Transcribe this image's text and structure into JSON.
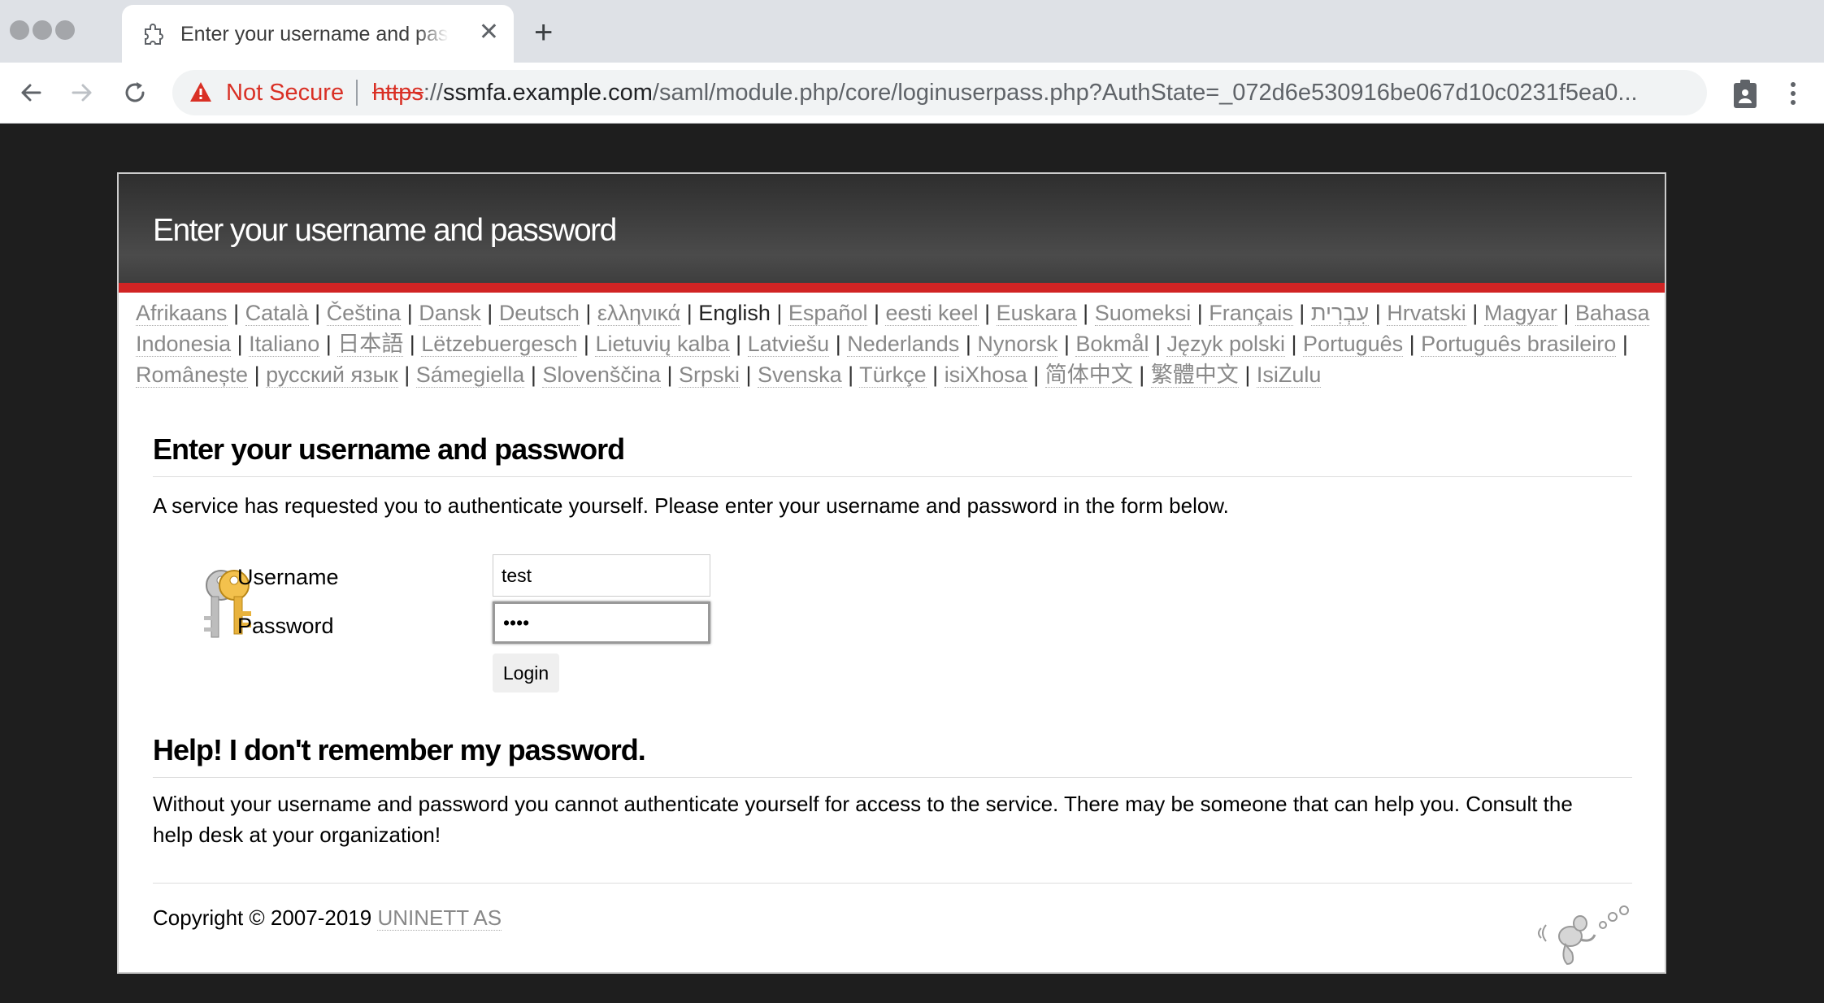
{
  "browser": {
    "tab_title": "Enter your username and password",
    "tab_close": "✕",
    "new_tab": "+",
    "security_label": "Not Secure",
    "url_scheme": "https",
    "url_sep": "://",
    "url_host": "ssmfa.example.com",
    "url_path": "/saml/module.php/core/loginuserpass.php?AuthState=_072d6e530916be067d10c0231f5ea0..."
  },
  "page": {
    "banner_title": "Enter your username and password",
    "languages": [
      {
        "label": "Afrikaans",
        "current": false
      },
      {
        "label": "Català",
        "current": false
      },
      {
        "label": "Čeština",
        "current": false
      },
      {
        "label": "Dansk",
        "current": false
      },
      {
        "label": "Deutsch",
        "current": false
      },
      {
        "label": "ελληνικά",
        "current": false
      },
      {
        "label": "English",
        "current": true
      },
      {
        "label": "Español",
        "current": false
      },
      {
        "label": "eesti keel",
        "current": false
      },
      {
        "label": "Euskara",
        "current": false
      },
      {
        "label": "Suomeksi",
        "current": false
      },
      {
        "label": "Français",
        "current": false
      },
      {
        "label": "עִבְרִית",
        "current": false
      },
      {
        "label": "Hrvatski",
        "current": false
      },
      {
        "label": "Magyar",
        "current": false
      },
      {
        "label": "Bahasa Indonesia",
        "current": false
      },
      {
        "label": "Italiano",
        "current": false
      },
      {
        "label": "日本語",
        "current": false
      },
      {
        "label": "Lëtzebuergesch",
        "current": false
      },
      {
        "label": "Lietuvių kalba",
        "current": false
      },
      {
        "label": "Latviešu",
        "current": false
      },
      {
        "label": "Nederlands",
        "current": false
      },
      {
        "label": "Nynorsk",
        "current": false
      },
      {
        "label": "Bokmål",
        "current": false
      },
      {
        "label": "Język polski",
        "current": false
      },
      {
        "label": "Português",
        "current": false
      },
      {
        "label": "Português brasileiro",
        "current": false
      },
      {
        "label": "Românește",
        "current": false
      },
      {
        "label": "русский язык",
        "current": false
      },
      {
        "label": "Sámegiella",
        "current": false
      },
      {
        "label": "Slovenščina",
        "current": false
      },
      {
        "label": "Srpski",
        "current": false
      },
      {
        "label": "Svenska",
        "current": false
      },
      {
        "label": "Türkçe",
        "current": false
      },
      {
        "label": "isiXhosa",
        "current": false
      },
      {
        "label": "简体中文",
        "current": false
      },
      {
        "label": "繁體中文",
        "current": false
      },
      {
        "label": "IsiZulu",
        "current": false
      }
    ],
    "language_separator": " | ",
    "login_heading": "Enter your username and password",
    "login_intro": "A service has requested you to authenticate yourself. Please enter your username and password in the form below.",
    "form": {
      "username_label": "Username",
      "username_value": "test",
      "password_label": "Password",
      "password_value": "test",
      "login_button": "Login"
    },
    "help_heading": "Help! I don't remember my password.",
    "help_text": "Without your username and password you cannot authenticate yourself for access to the service. There may be someone that can help you. Consult the help desk at your organization!",
    "copyright_prefix": "Copyright © 2007-2019 ",
    "copyright_org": "UNINETT AS"
  }
}
